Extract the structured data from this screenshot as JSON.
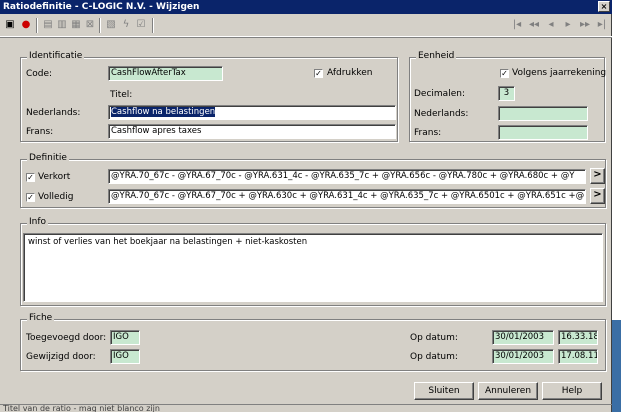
{
  "window": {
    "title": "Ratiodefinitie - C-LOGIC N.V. - Wijzigen",
    "close": "×"
  },
  "toolbar": {
    "icons": [
      "edit-icon",
      "stop-icon",
      "insert-row-icon",
      "edit-row-icon",
      "delete-row-icon",
      "cancel-row-icon",
      "print-icon",
      "bolt-icon",
      "check-icon"
    ],
    "nav": [
      "|◂",
      "◂◂",
      "◂",
      "▸",
      "▸▸",
      "▸|"
    ]
  },
  "identificatie": {
    "legend": "Identificatie",
    "code_label": "Code:",
    "code_value": "CashFlowAfterTax",
    "afdrukken_label": "Afdrukken",
    "titel_label": "Titel:",
    "nederlands_label": "Nederlands:",
    "nederlands_value": "Cashflow na belastingen",
    "frans_label": "Frans:",
    "frans_value": "Cashflow apres taxes"
  },
  "eenheid": {
    "legend": "Eenheid",
    "volgens_label": "Volgens jaarrekening",
    "decimalen_label": "Decimalen:",
    "decimalen_value": "3",
    "nederlands_label": "Nederlands:",
    "nederlands_value": "",
    "frans_label": "Frans:",
    "frans_value": ""
  },
  "definitie": {
    "legend": "Definitie",
    "verkort_label": "Verkort",
    "verkort_value": "@YRA.70_67c - @YRA.67_70c - @YRA.631_4c - @YRA.635_7c + @YRA.656c - @YRA.780c + @YRA.680c + @Y",
    "volledig_label": "Volledig",
    "volledig_value": "@YRA.70_67c - @YRA.67_70c + @YRA.630c + @YRA.631_4c + @YRA.635_7c + @YRA.6501c + @YRA.651c +@",
    "more": ">"
  },
  "info": {
    "legend": "Info",
    "text": "winst of verlies van het boekjaar na belastingen + niet-kaskosten"
  },
  "fiche": {
    "legend": "Fiche",
    "toegevoegd_label": "Toegevoegd door:",
    "toegevoegd_value": "IGO",
    "gewijzigd_label": "Gewijzigd door:",
    "gewijzigd_value": "IGO",
    "op_datum_label": "Op datum:",
    "datum1": "30/01/2003",
    "tijd1": "16.33.18",
    "datum2": "30/01/2003",
    "tijd2": "17.08.11"
  },
  "buttons": {
    "sluiten": "Sluiten",
    "annuleren": "Annuleren",
    "help": "Help"
  },
  "status": "Titel van de ratio - mag niet blanco zijn"
}
